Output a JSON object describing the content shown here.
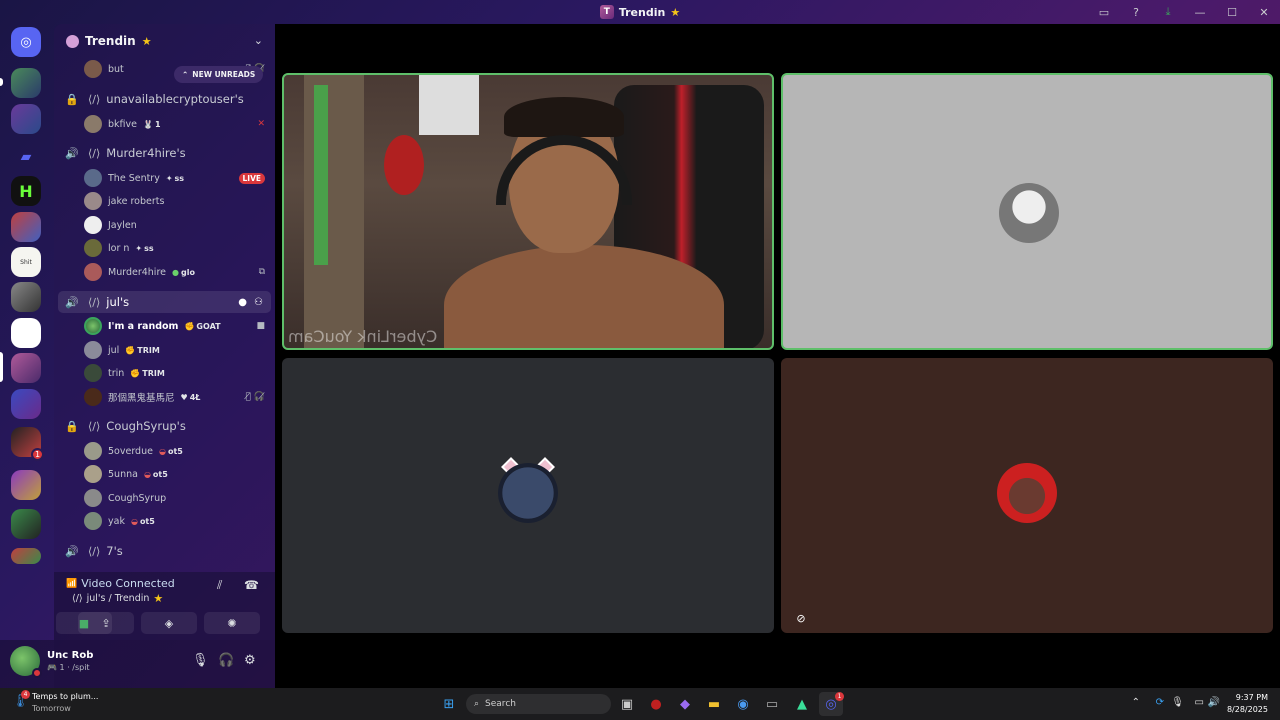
{
  "window": {
    "title": "Trendin"
  },
  "guild": {
    "name": "Trendin",
    "new_unreads": "NEW UNREADS"
  },
  "channels": [
    {
      "name": "unavailablecryptouser's",
      "locked": true,
      "users": [
        {
          "name": "bkfive",
          "tag": "1"
        }
      ]
    },
    {
      "name": "Murder4hire's",
      "locked": false,
      "users": [
        {
          "name": "The Sentry",
          "tag": "ss",
          "live": "LIVE"
        },
        {
          "name": "jake roberts"
        },
        {
          "name": "Jaylen"
        },
        {
          "name": "lor n",
          "tag": "ss"
        },
        {
          "name": "Murder4hire",
          "tag": "glo"
        }
      ]
    },
    {
      "name": "jul's",
      "locked": false,
      "active": true,
      "users": [
        {
          "name": "I'm a random",
          "tag": "GOAT"
        },
        {
          "name": "jul",
          "tag": "TRIM"
        },
        {
          "name": "trin",
          "tag": "TRIM"
        },
        {
          "name": "那個黑鬼基馬尼",
          "tag": "4Ł"
        }
      ]
    },
    {
      "name": "CoughSyrup's",
      "locked": true,
      "users": [
        {
          "name": "5overdue",
          "tag": "ot5"
        },
        {
          "name": "5unna",
          "tag": "ot5"
        },
        {
          "name": "CoughSyrup"
        },
        {
          "name": "yak",
          "tag": "ot5"
        }
      ]
    },
    {
      "name": "7's",
      "locked": false,
      "users": []
    }
  ],
  "first_user_partial": "but",
  "voice": {
    "status": "Video Connected",
    "location": "jul's / Trendin"
  },
  "user": {
    "name": "Unc Rob",
    "status": "/spit",
    "level": "1"
  },
  "server_badge": "1",
  "video": {
    "watermark": "CyberLink YouCam"
  },
  "taskbar": {
    "weather_title": "Temps to plum...",
    "weather_sub": "Tomorrow",
    "weather_badge": "4",
    "search_placeholder": "Search",
    "discord_badge": "1",
    "time": "9:37 PM",
    "date": "8/28/2025"
  },
  "colors": {
    "accent_green": "#5fbf6a",
    "live_red": "#da373c",
    "star": "#f5c518"
  }
}
